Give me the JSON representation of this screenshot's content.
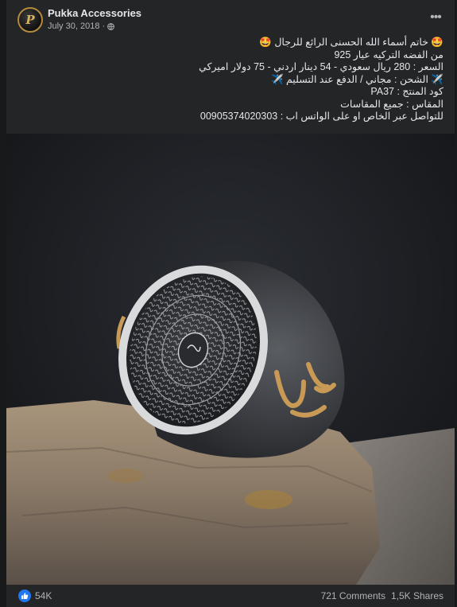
{
  "post": {
    "page_name": "Pukka Accessories",
    "date": "July 30, 2018",
    "separator": "·",
    "avatar_letter": "P",
    "more_icon": "more-options-icon",
    "audience_icon": "globe-icon",
    "text_lines": [
      "🤩 خاتم أسماء الله الحسنى الرائع للرجال 🤩",
      "من الفضه التركيه عيار 925",
      "السعر : 280 ريال سعودي - 54 دينار اردني - 75 دولار اميركي",
      "✈️ الشحن : مجاني / الدفع عند التسليم ✈️",
      "كود المنتج : PA37",
      "المقاس : جميع المقاسات",
      "للتواصل عبر الخاص او على الواتس اب : 00905374020303"
    ],
    "reactions": {
      "icon": "like-icon",
      "count": "54K"
    },
    "comments": "721 Comments",
    "shares": "1,5K Shares"
  },
  "colors": {
    "background": "#18191a",
    "card": "#242526",
    "text": "#e4e6eb",
    "secondary_text": "#b0b3b8",
    "like_blue": "#2078f4"
  }
}
